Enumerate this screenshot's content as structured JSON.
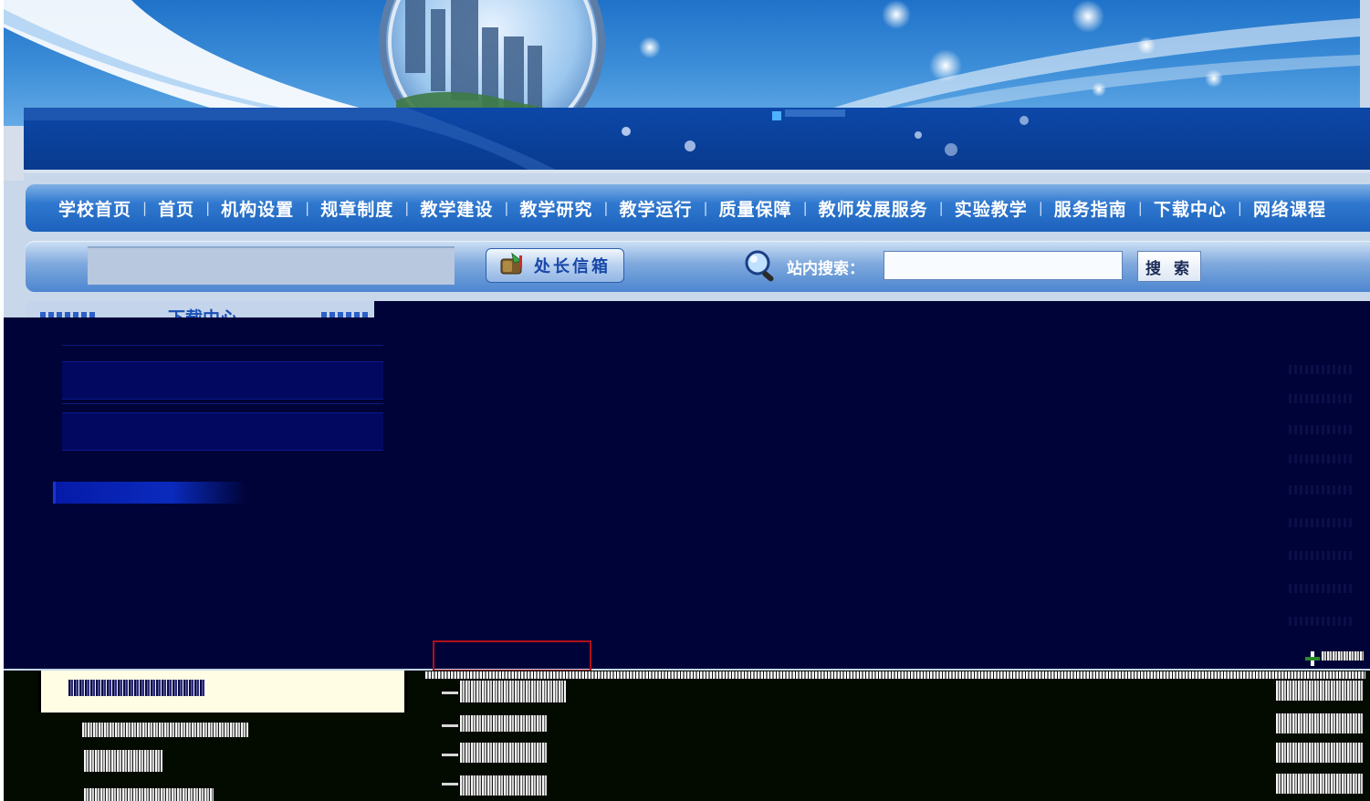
{
  "nav": {
    "items": [
      "学校首页",
      "首页",
      "机构设置",
      "规章制度",
      "教学建设",
      "教学研究",
      "教学运行",
      "质量保障",
      "教师发展服务",
      "实验教学",
      "服务指南",
      "下载中心",
      "网络课程"
    ],
    "separator": "|"
  },
  "toolbar": {
    "mailbox_label": "处长信箱",
    "search_label": "站内搜索：",
    "search_value": "",
    "search_button": "搜 索"
  },
  "sidebar": {
    "title": "下载中心"
  },
  "colors": {
    "banner_blue": "#1f72c9",
    "nav_blue": "#1d62bd",
    "overlay_navy": "#000337",
    "title_blue": "#1a4fb4"
  }
}
